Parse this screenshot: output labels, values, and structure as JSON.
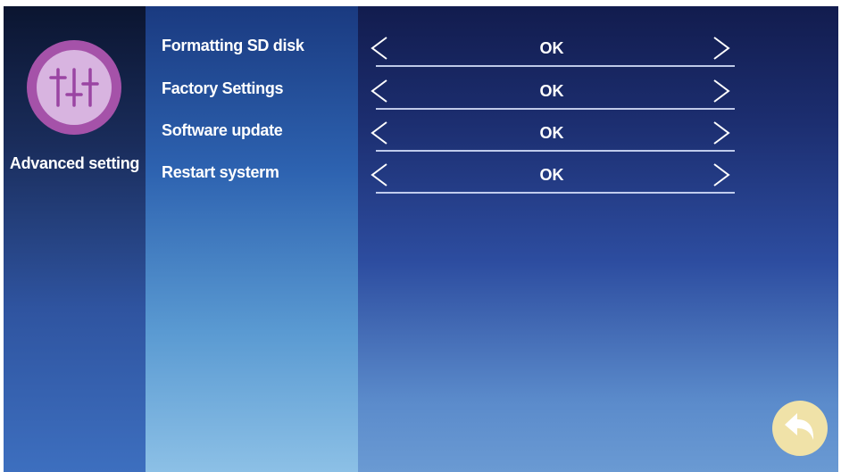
{
  "sidebar": {
    "title": "Advanced setting",
    "icon": "sliders-icon"
  },
  "settings": [
    {
      "label": "Formatting SD  disk",
      "value": "OK"
    },
    {
      "label": "Factory Settings",
      "value": "OK"
    },
    {
      "label": "Software update",
      "value": "OK"
    },
    {
      "label": "Restart systerm",
      "value": "OK"
    }
  ],
  "back_button": {
    "icon": "back-arrow-icon"
  },
  "colors": {
    "sidebar_dark": "#0b1530",
    "icon_ring": "#a552a9",
    "icon_fill": "#d8b4e0",
    "main_dark": "#121c4e",
    "back_button": "#f0e2a8",
    "text": "#ffffff"
  }
}
